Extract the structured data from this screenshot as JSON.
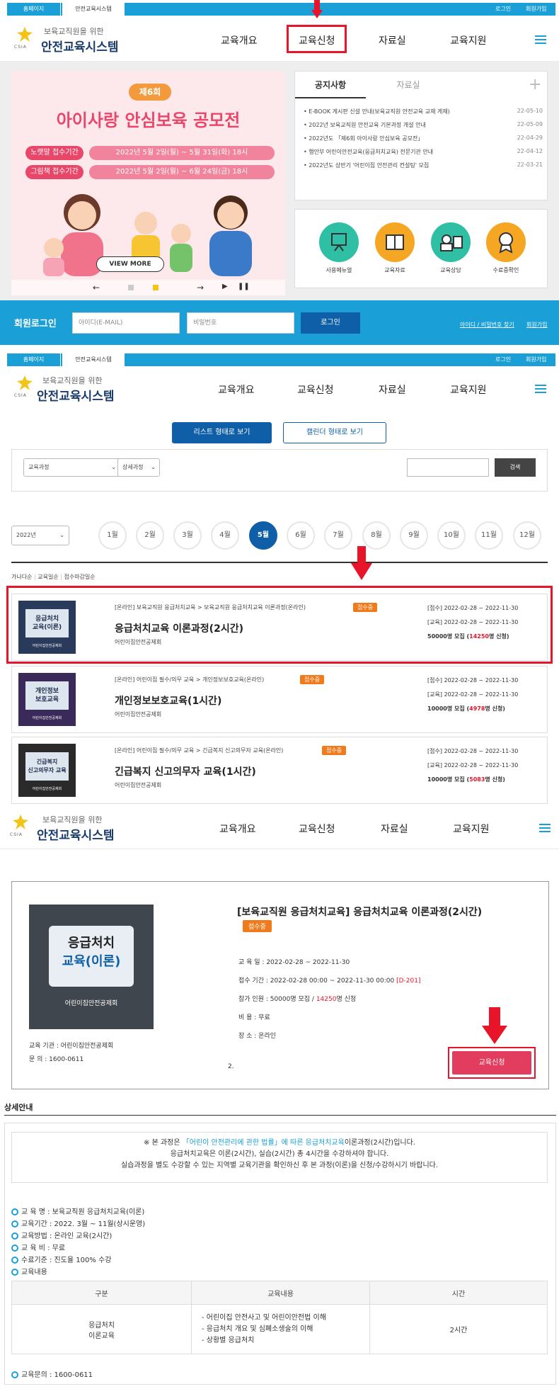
{
  "topbar": {
    "tab_home": "홈페이지",
    "tab_system": "안전교육시스템",
    "login": "로그인",
    "join": "회원가입"
  },
  "logo": {
    "sub": "보육교직원을 위한",
    "main": "안전교육시스템",
    "abbr": "CSIA"
  },
  "gnb": {
    "about": "교육개요",
    "apply": "교육신청",
    "data": "자료실",
    "support": "교육지원"
  },
  "banner": {
    "round": "제6회",
    "title": "아이사랑 안심보육 공모전",
    "row1_tag": "노랫말 접수기간",
    "row1_date": "2022년 5월 2일(월) ~ 5월 31일(화) 18시",
    "row2_tag": "그림책 접수기간",
    "row2_date": "2022년 5월 2일(월) ~ 6월 24일(금) 18시",
    "view_more": "VIEW MORE"
  },
  "notice": {
    "tab_notice": "공지사항",
    "tab_data": "자료실",
    "items": [
      {
        "text": "E-BOOK 게시판 신설 안내(보육교직원 안전교육 교재 게재)",
        "date": "22-05-10"
      },
      {
        "text": "2022년 보육교직원 안전교육 기본과정 개설 안내",
        "date": "22-05-09"
      },
      {
        "text": "2022년도 「제6회 아이사랑 안심보육 공모전」",
        "date": "22-04-29"
      },
      {
        "text": "행안부 어린이안전교육(응급처치교육) 전문기관 안내",
        "date": "22-04-12"
      },
      {
        "text": "2022년도 상반기 '어린이집 안전관리 컨설팅' 모집",
        "date": "22-03-21"
      }
    ]
  },
  "quick": [
    {
      "label": "사용메뉴얼",
      "color": "#2fbfa4"
    },
    {
      "label": "교육자료",
      "color": "#f5a623"
    },
    {
      "label": "교육상담",
      "color": "#2fbfa4"
    },
    {
      "label": "수료증확인",
      "color": "#f5a623"
    }
  ],
  "member": {
    "title": "회원로그인",
    "id_ph": "아이디(E-MAIL)",
    "pw_ph": "비밀번호",
    "login_btn": "로그인",
    "find": "아이디 / 비밀번호 찾기",
    "join": "회원가입"
  },
  "list_view": {
    "list_btn": "리스트 형태로 보기",
    "cal_btn": "캘린더 형태로 보기",
    "sel_course": "교육과정",
    "sel_detail": "상세과정",
    "search_btn": "검색",
    "year": "2022년",
    "months": [
      "1월",
      "2월",
      "3월",
      "4월",
      "5월",
      "6월",
      "7월",
      "8월",
      "9월",
      "10월",
      "11월",
      "12월"
    ],
    "active_month": 4,
    "sort": [
      "가나다순",
      "교육일순",
      "접수마감일순"
    ]
  },
  "courses": [
    {
      "thumb1": "응급처치",
      "thumb2": "교육(이론)",
      "cat": "[온라인] 보육교직원 응급처치교육 > 보육교직원 응급처치교육 이론과정(온라인)",
      "badge": "접수중",
      "title": "응급처치교육 이론과정(2시간)",
      "org": "어린이집안전공제회",
      "recv": "[접수] 2022-02-28 ~ 2022-11-30",
      "edu": "[교육] 2022-02-28 ~ 2022-11-30",
      "cap1": "50000명 모집 (",
      "cnt": "14250",
      "cap2": "명 신청)"
    },
    {
      "thumb1": "개인정보",
      "thumb2": "보호교육",
      "cat": "[온라인] 어린이집 필수/의무 교육 > 개인정보보호교육(온라인)",
      "badge": "접수중",
      "title": "개인정보보호교육(1시간)",
      "org": "어린이집안전공제회",
      "recv": "[접수] 2022-02-28 ~ 2022-11-30",
      "edu": "[교육] 2022-02-28 ~ 2022-11-30",
      "cap1": "10000명 모집 (",
      "cnt": "4978",
      "cap2": "명 신청)"
    },
    {
      "thumb1": "긴급복지",
      "thumb2": "신고의무자 교육",
      "cat": "[온라인] 어린이집 필수/의무 교육 > 긴급복지 신고의무자 교육(온라인)",
      "badge": "접수중",
      "title": "긴급복지 신고의무자 교육(1시간)",
      "org": "어린이집안전공제회",
      "recv": "[접수] 2022-02-28 ~ 2022-11-30",
      "edu": "[교육] 2022-02-28 ~ 2022-11-30",
      "cap1": "10000명 모집 (",
      "cnt": "5083",
      "cap2": "명 신청)"
    }
  ],
  "detail": {
    "thumb1": "응급처치",
    "thumb2": "교육(이론)",
    "thumb_org": "어린이집안전공제회",
    "title": "[보육교직원 응급처치교육] 응급처치교육 이론과정(2시간)",
    "badge": "접수중",
    "edu_date": "교 육 일 : 2022-02-28 ~ 2022-11-30",
    "recv_date": "접수 기간 : 2022-02-28 00:00 ~ 2022-11-30 00:00",
    "dday": "[D-201]",
    "people1": "참가 인원 : 50000명 모집 / ",
    "people_cnt": "14250",
    "people2": "명 신청",
    "fee": "비      용 : 무료",
    "place": "장      소 : 온라인",
    "org": "교육 기관 : 어린이집안전공제회",
    "tel": "문      의 : 1600-0611",
    "num": "2.",
    "apply_btn": "교육신청"
  },
  "info": {
    "section_title": "상세안내",
    "notice_pre": "※ 본 과정은 ",
    "notice_link": "「어린이 안전관리에 관한 법률」에 따른 응급처치교육",
    "notice_post": "이론과정(2시간)입니다.",
    "notice_l2": "응급처치교육은 이론(2시간), 실습(2시간) 총 4시간을 수강하셔야 합니다.",
    "notice_l3": "실습과정을 별도 수강할 수 있는 지역별 교육기관을 확인하신 후 본 과정(이론)을 신청/수강하시기 바랍니다.",
    "bullets": [
      "교 육 명 : 보육교직원 응급처치교육(이론)",
      "교육기간 : 2022. 3월 ~ 11월(상시운영)",
      "교육방법 : 온라인 교육(2시간)",
      "교 육 비 : 무료",
      "수료기준 : 진도율 100% 수강",
      "교육내용"
    ],
    "th": [
      "구분",
      "교육내용",
      "시간"
    ],
    "td_name1": "응급처치",
    "td_name2": "이론교육",
    "td_c1": "- 어린이집 안전사고 및 어린이안전법 이해",
    "td_c2": "- 응급처치 개요 및 심폐소생술의 이해",
    "td_c3": "- 상황별 응급처치",
    "td_time": "2시간",
    "contact": "교육문의 : 1600-0611"
  }
}
